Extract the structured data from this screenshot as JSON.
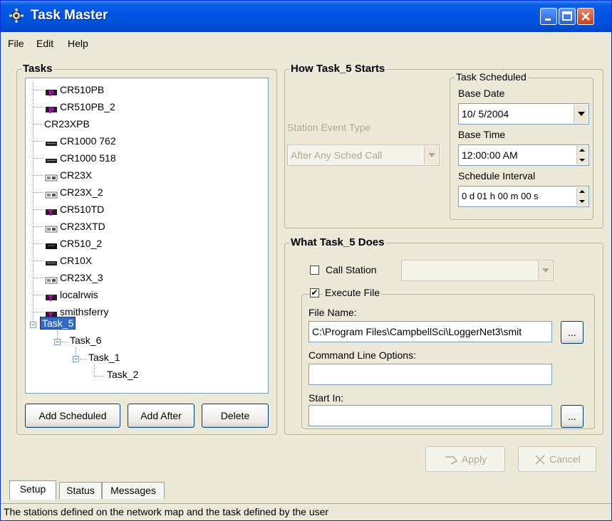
{
  "window": {
    "title": "Task Master"
  },
  "menu": [
    "File",
    "Edit",
    "Help"
  ],
  "tasks_group": {
    "label": "Tasks",
    "stations": [
      {
        "label": "CR510PB",
        "icon": "pb-logger-icon"
      },
      {
        "label": "CR510PB_2",
        "icon": "pb-logger-icon"
      },
      {
        "label": "CR23XPB",
        "icon": ""
      },
      {
        "label": "CR1000 762",
        "icon": "cr1000-logger-icon"
      },
      {
        "label": "CR1000 518",
        "icon": "cr1000-logger-icon"
      },
      {
        "label": "CR23X",
        "icon": "cr23x-logger-icon"
      },
      {
        "label": "CR23X_2",
        "icon": "cr23x-logger-icon"
      },
      {
        "label": "CR510TD",
        "icon": "td-logger-icon"
      },
      {
        "label": "CR23XTD",
        "icon": "cr23x-logger-icon"
      },
      {
        "label": "CR510_2",
        "icon": "cr510-logger-icon"
      },
      {
        "label": "CR10X",
        "icon": "cr1000-logger-icon"
      },
      {
        "label": "CR23X_3",
        "icon": "cr23x-logger-icon"
      },
      {
        "label": "localrwis",
        "icon": "td-logger-icon"
      },
      {
        "label": "smithsferry",
        "icon": "td-logger-icon"
      }
    ],
    "tasks": [
      "Task_5",
      "Task_6",
      "Task_1",
      "Task_2"
    ],
    "buttons": {
      "add_scheduled": "Add Scheduled",
      "add_after": "Add After",
      "delete": "Delete"
    }
  },
  "how_starts": {
    "label": "How Task_5 Starts",
    "station_event_label": "Station Event Type",
    "station_event_value": "After Any Sched Call",
    "scheduled": {
      "label": "Task Scheduled",
      "base_date_label": "Base Date",
      "base_date": "10/ 5/2004",
      "base_time_label": "Base Time",
      "base_time": "12:00:00 AM",
      "interval_label": "Schedule Interval",
      "interval": "0 d 01 h 00 m 00 s"
    }
  },
  "what_does": {
    "label": "What Task_5 Does",
    "call_station_label": "Call Station",
    "call_station_checked": false,
    "execute_file_label": "Execute File",
    "execute_file_checked": true,
    "file_name_label": "File Name:",
    "file_name": "C:\\Program Files\\CampbellSci\\LoggerNet3\\smit",
    "cmd_options_label": "Command Line Options:",
    "cmd_options": "",
    "start_in_label": "Start In:",
    "start_in": "",
    "browse": "..."
  },
  "footer_buttons": {
    "apply": "Apply",
    "cancel": "Cancel"
  },
  "tabs": [
    "Setup",
    "Status",
    "Messages"
  ],
  "status_text": "The stations defined on the network map and the task defined by the user",
  "colors": {
    "titlebar": "#0054e3",
    "selection": "#316ac5",
    "window_bg": "#ece9d8",
    "pink_icon": "#d400d4"
  }
}
